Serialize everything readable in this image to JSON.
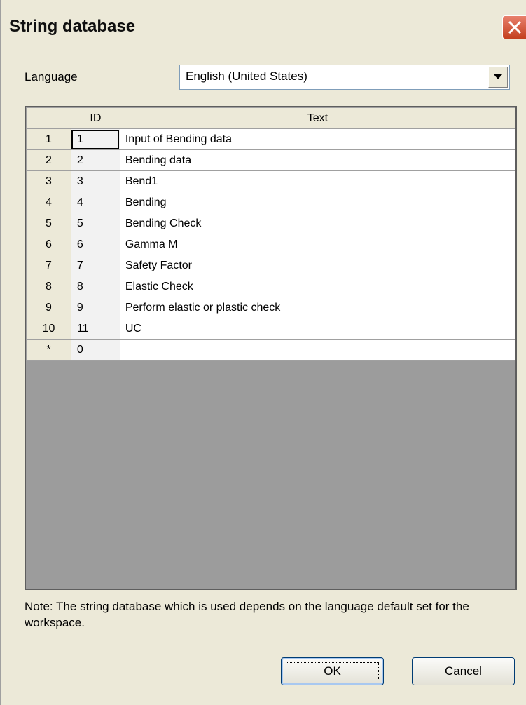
{
  "window": {
    "title": "String database"
  },
  "language": {
    "label": "Language",
    "selected": "English (United States)"
  },
  "grid": {
    "columns": [
      "ID",
      "Text"
    ],
    "rows": [
      {
        "num": "1",
        "id": "1",
        "text": "Input of Bending data"
      },
      {
        "num": "2",
        "id": "2",
        "text": "Bending data"
      },
      {
        "num": "3",
        "id": "3",
        "text": "Bend1"
      },
      {
        "num": "4",
        "id": "4",
        "text": "Bending"
      },
      {
        "num": "5",
        "id": "5",
        "text": "Bending Check"
      },
      {
        "num": "6",
        "id": "6",
        "text": "Gamma M"
      },
      {
        "num": "7",
        "id": "7",
        "text": "Safety Factor"
      },
      {
        "num": "8",
        "id": "8",
        "text": "Elastic Check"
      },
      {
        "num": "9",
        "id": "9",
        "text": "Perform elastic or plastic check"
      },
      {
        "num": "10",
        "id": "11",
        "text": "UC"
      }
    ],
    "new_row": {
      "num": "*",
      "id": "0",
      "text": ""
    }
  },
  "note": "Note: The string database which is used depends on the language default set for the workspace.",
  "buttons": {
    "ok": "OK",
    "cancel": "Cancel"
  },
  "icons": {
    "close": "close-icon",
    "dropdown": "chevron-down-icon"
  }
}
